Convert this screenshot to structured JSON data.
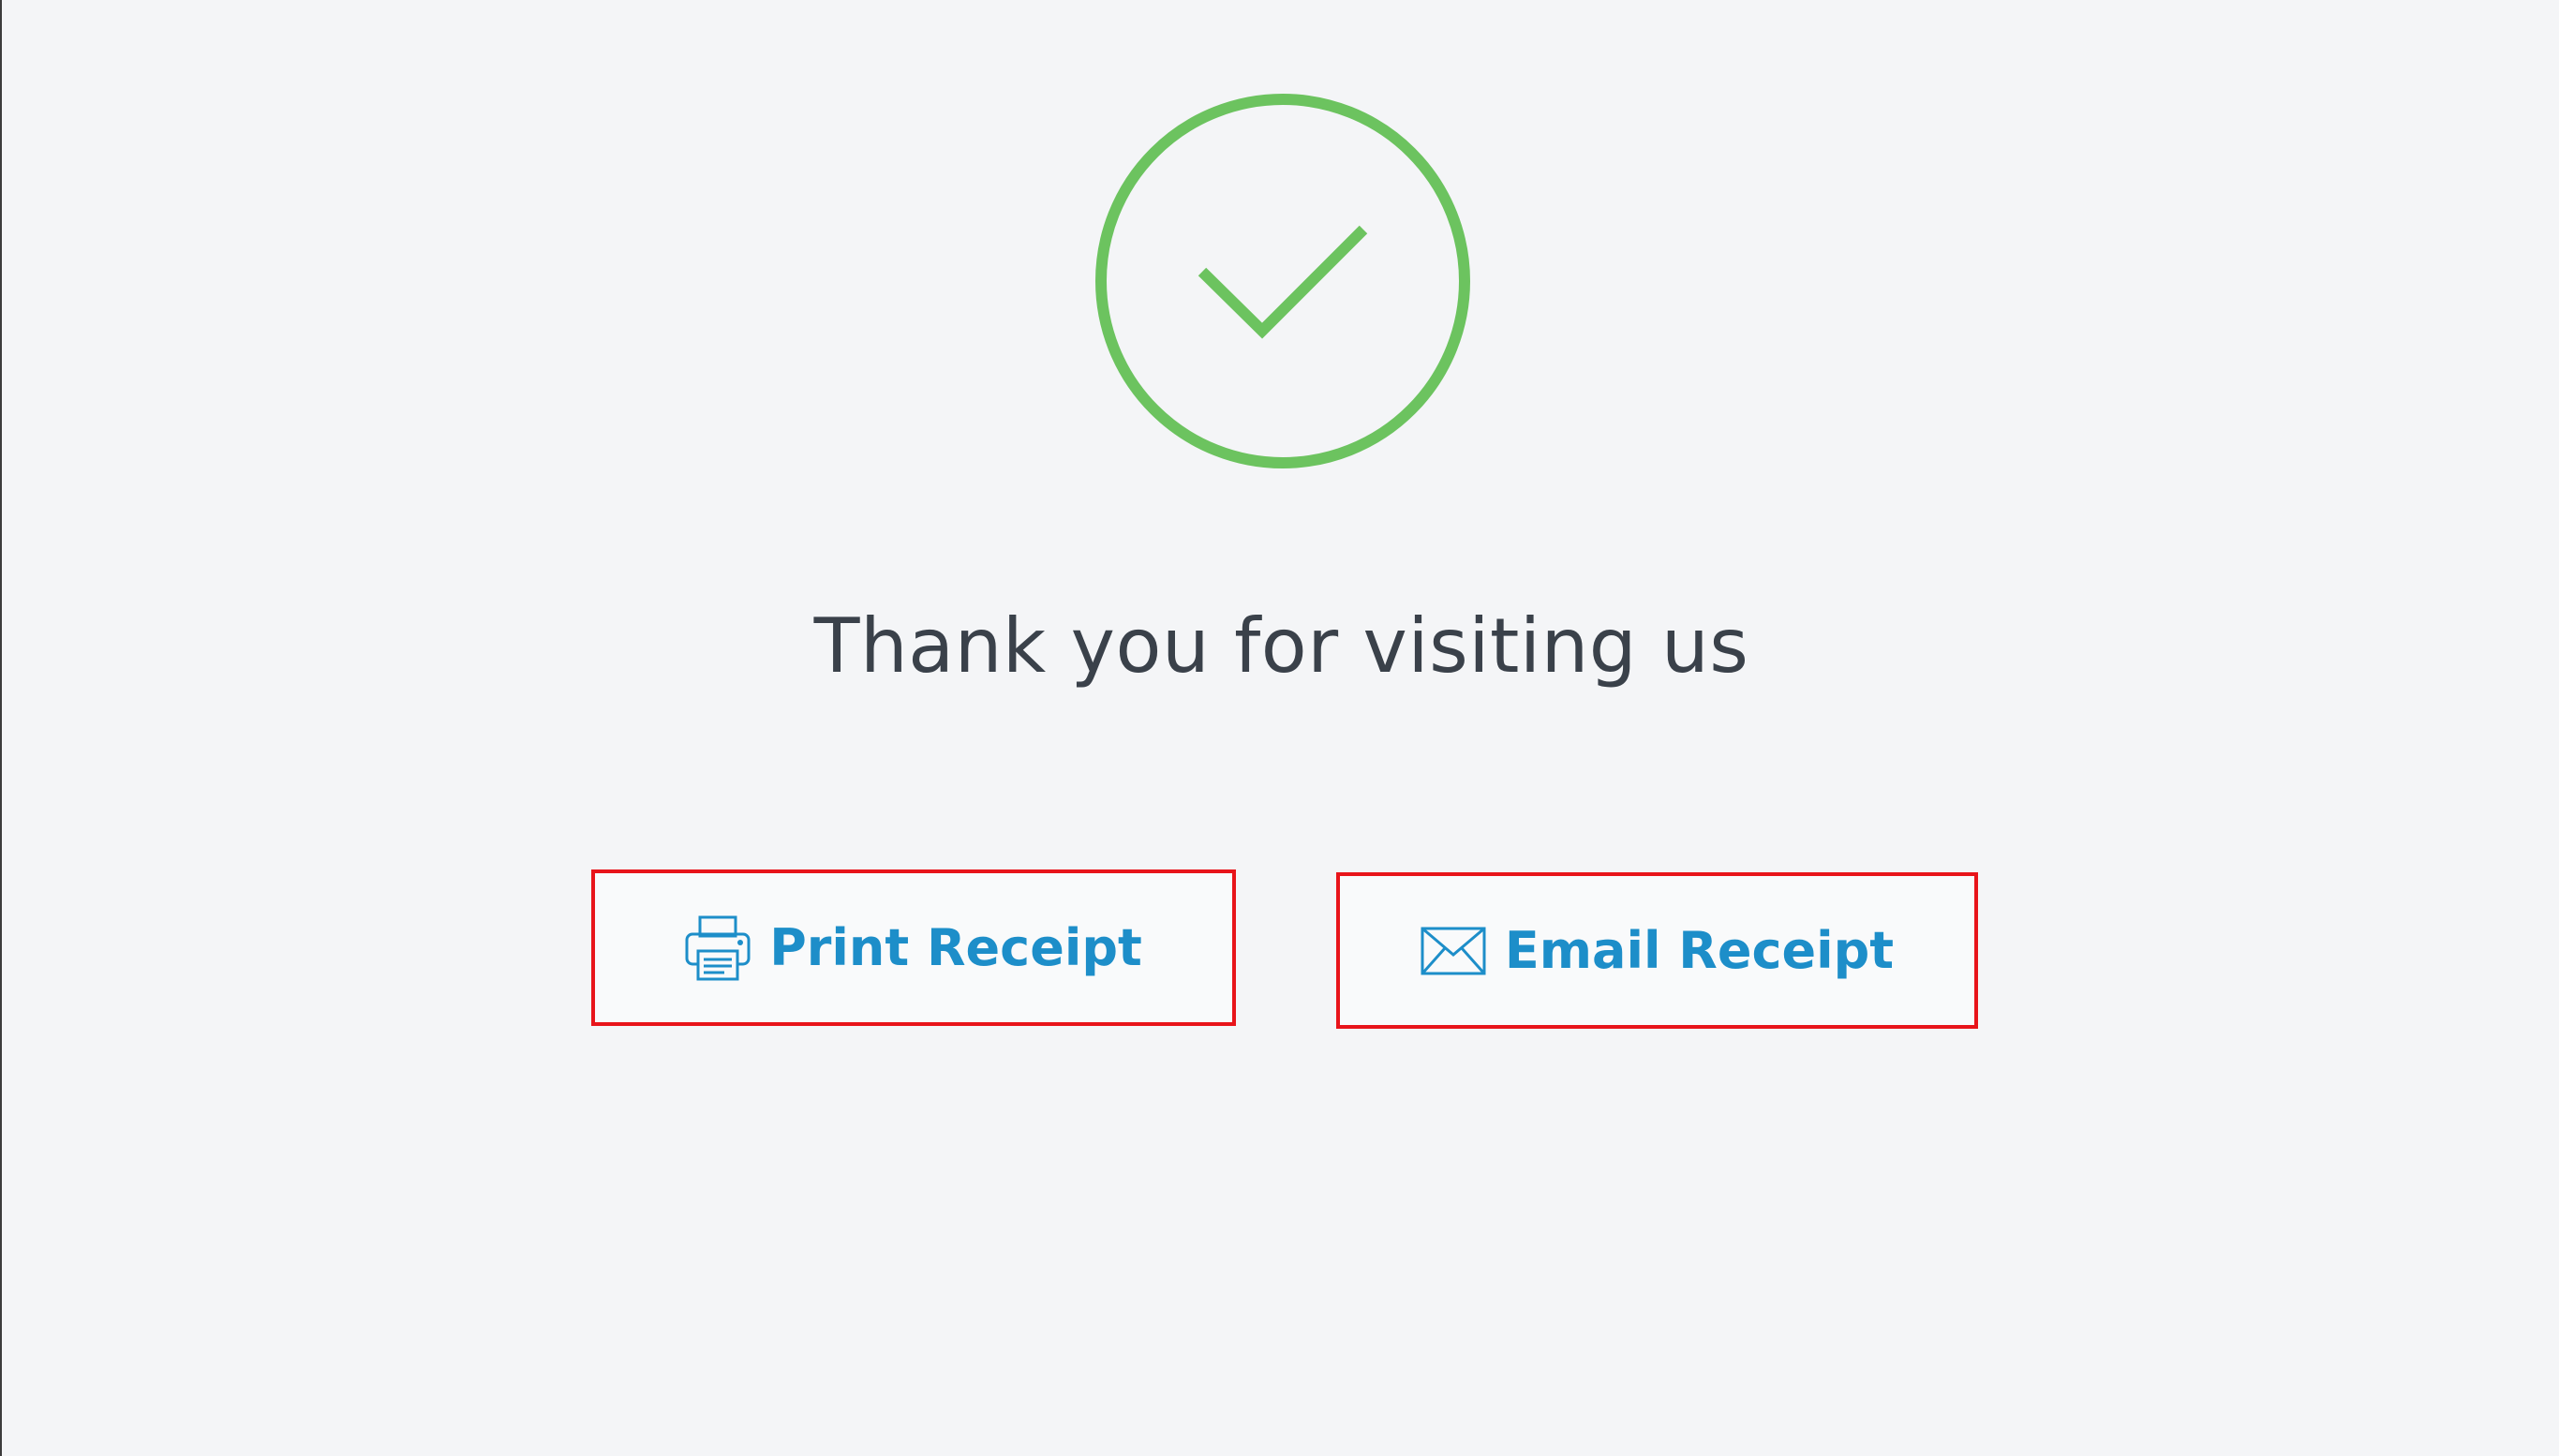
{
  "confirmation": {
    "icon": "check-circle-icon",
    "title": "Thank you for visiting us"
  },
  "actions": {
    "print": {
      "icon": "printer-icon",
      "label": "Print Receipt"
    },
    "email": {
      "icon": "envelope-icon",
      "label": "Email Receipt"
    }
  },
  "colors": {
    "background": "#f4f5f7",
    "success": "#6cc35f",
    "title_text": "#3a414a",
    "action_text": "#1d8ec9",
    "highlight_border": "#e8141a"
  }
}
